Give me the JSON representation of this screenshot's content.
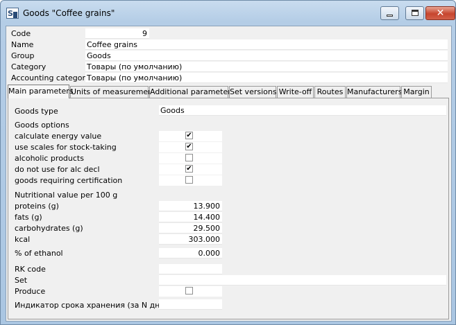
{
  "window": {
    "title": "Goods \"Coffee grains\"",
    "app_icon": "app-logo-icon",
    "close_glyph": "✕"
  },
  "header": {
    "code_label": "Code",
    "code_value": "9",
    "name_label": "Name",
    "name_value": "Coffee grains",
    "group_label": "Group",
    "group_value": "Goods",
    "category_label": "Category",
    "category_value": "Товары (по умолчанию)",
    "accounting_category_label": "Accounting category",
    "accounting_category_value": "Товары (по умолчанию)"
  },
  "tabs": [
    {
      "label": "Main parameters",
      "active": true
    },
    {
      "label": "Units of measurement"
    },
    {
      "label": "Additional parameters"
    },
    {
      "label": "Set versions"
    },
    {
      "label": "Write-off"
    },
    {
      "label": "Routes"
    },
    {
      "label": "Manufacturers"
    },
    {
      "label": "Margin"
    }
  ],
  "main": {
    "goods_type_label": "Goods type",
    "goods_type_value": "Goods",
    "goods_options_heading": "Goods options",
    "options": [
      {
        "label": "calculate energy value",
        "checked": true,
        "mark": "✔"
      },
      {
        "label": "use scales for stock-taking",
        "checked": true,
        "mark": "✔"
      },
      {
        "label": "alcoholic products",
        "checked": false,
        "mark": ""
      },
      {
        "label": "do not use for alc decl",
        "checked": true,
        "mark": "✔"
      },
      {
        "label": "goods requiring certification",
        "checked": false,
        "mark": ""
      }
    ],
    "nutrition_heading": "Nutritional value per 100 g",
    "nutrition": [
      {
        "label": "proteins (g)",
        "value": "13.900"
      },
      {
        "label": "fats (g)",
        "value": "14.400"
      },
      {
        "label": "carbohydrates (g)",
        "value": "29.500"
      },
      {
        "label": "kcal",
        "value": "303.000"
      }
    ],
    "ethanol_label": "% of ethanol",
    "ethanol_value": "0.000",
    "rk_code_label": "RK code",
    "rk_code_value": "",
    "set_label": "Set",
    "set_value": "",
    "produce_label": "Produce",
    "produce_checked": false,
    "produce_mark": "",
    "shelf_life_label": "Индикатор срока хранения (за N дней)",
    "shelf_life_value": ""
  }
}
